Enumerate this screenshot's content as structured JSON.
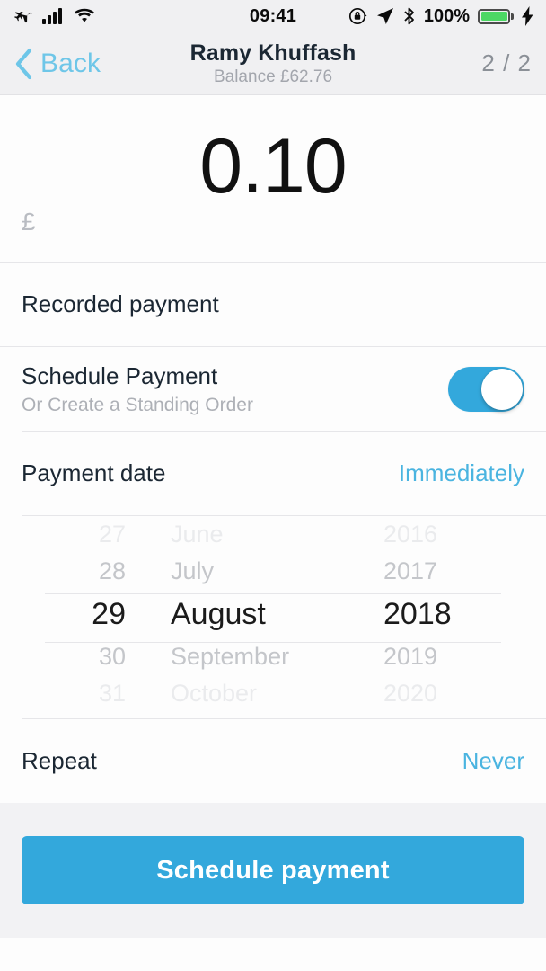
{
  "status_bar": {
    "airplane_icon": "airplane-mode-icon",
    "signal_icon": "cellular-signal-icon",
    "wifi_icon": "wifi-icon",
    "time": "09:41",
    "rotation_lock_icon": "rotation-lock-icon",
    "location_icon": "location-arrow-icon",
    "bluetooth_icon": "bluetooth-icon",
    "battery_percent": "100%",
    "battery_icon": "battery-full-icon",
    "charging_icon": "lightning-bolt-icon"
  },
  "nav": {
    "back_label": "Back",
    "back_icon": "chevron-left-icon",
    "title": "Ramy Khuffash",
    "subtitle": "Balance £62.76",
    "page_indicator": "2 / 2"
  },
  "amount": {
    "value": "0.10",
    "currency_symbol": "£"
  },
  "rows": {
    "recorded_payment_label": "Recorded payment",
    "schedule_payment_label": "Schedule Payment",
    "schedule_payment_sublabel": "Or Create a Standing Order",
    "schedule_toggle_state": "on",
    "payment_date_label": "Payment date",
    "payment_date_value": "Immediately",
    "repeat_label": "Repeat",
    "repeat_value": "Never"
  },
  "date_picker": {
    "days": [
      "27",
      "28",
      "29",
      "30",
      "31"
    ],
    "months": [
      "June",
      "July",
      "August",
      "September",
      "October"
    ],
    "years": [
      "2016",
      "2017",
      "2018",
      "2019",
      "2020"
    ],
    "selected_day": "29",
    "selected_month": "August",
    "selected_year": "2018"
  },
  "footer": {
    "cta_label": "Schedule payment"
  },
  "colors": {
    "accent": "#33a8dc",
    "link": "#4ab4e0",
    "back_link": "#6ec6e8",
    "battery_green": "#4cd764",
    "bar_background": "#f0f0f2",
    "footer_background": "#f2f2f4"
  }
}
